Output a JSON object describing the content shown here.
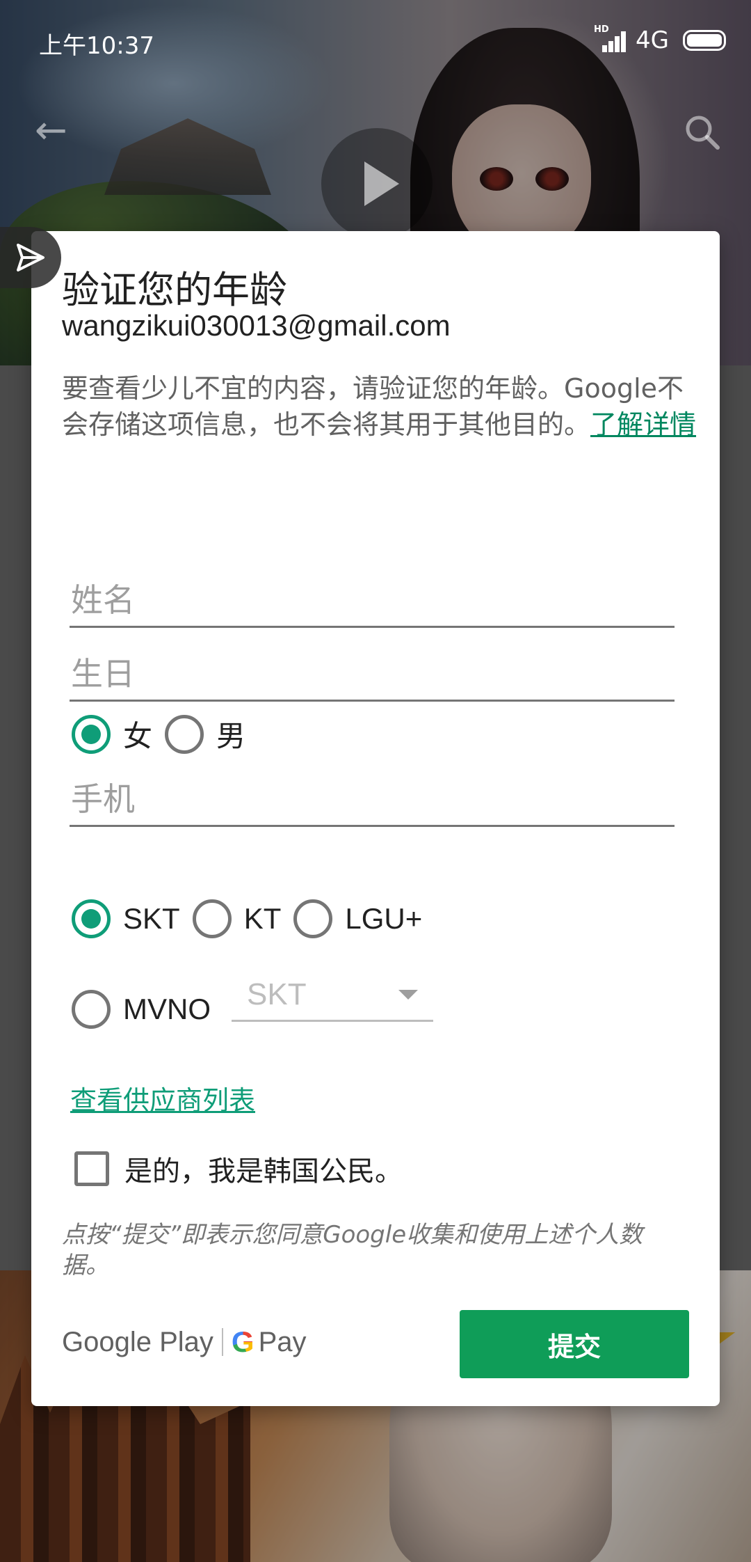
{
  "status_bar": {
    "time": "上午10:37",
    "network": "4G",
    "hd": "HD"
  },
  "dialog": {
    "title": "验证您的年龄",
    "email": "wangzikui030013@gmail.com",
    "description": "要查看少儿不宜的内容，请验证您的年龄。Google不会存储这项信息，也不会将其用于其他目的。",
    "learn_more": "了解详情",
    "name_placeholder": "姓名",
    "birthday_placeholder": "生日",
    "gender_options": [
      {
        "label": "女",
        "checked": true
      },
      {
        "label": "男",
        "checked": false
      }
    ],
    "phone_placeholder": "手机",
    "carrier_options": [
      {
        "label": "SKT",
        "checked": true
      },
      {
        "label": "KT",
        "checked": false
      },
      {
        "label": "LGU+",
        "checked": false
      }
    ],
    "mvno_option": {
      "label": "MVNO",
      "checked": false
    },
    "mvno_select_value": "SKT",
    "provider_list_link": "查看供应商列表",
    "citizen_checkbox_label": "是的，我是韩国公民。",
    "citizen_checked": false,
    "consent_text": "点按“提交”即表示您同意Google收集和使用上述个人数据。",
    "footer": {
      "google_play": "Google Play",
      "g": "G",
      "pay": "Pay"
    },
    "submit_label": "提交"
  },
  "colors": {
    "accent": "#0f9d78",
    "submit": "#0f9d58",
    "link": "#01875f"
  }
}
